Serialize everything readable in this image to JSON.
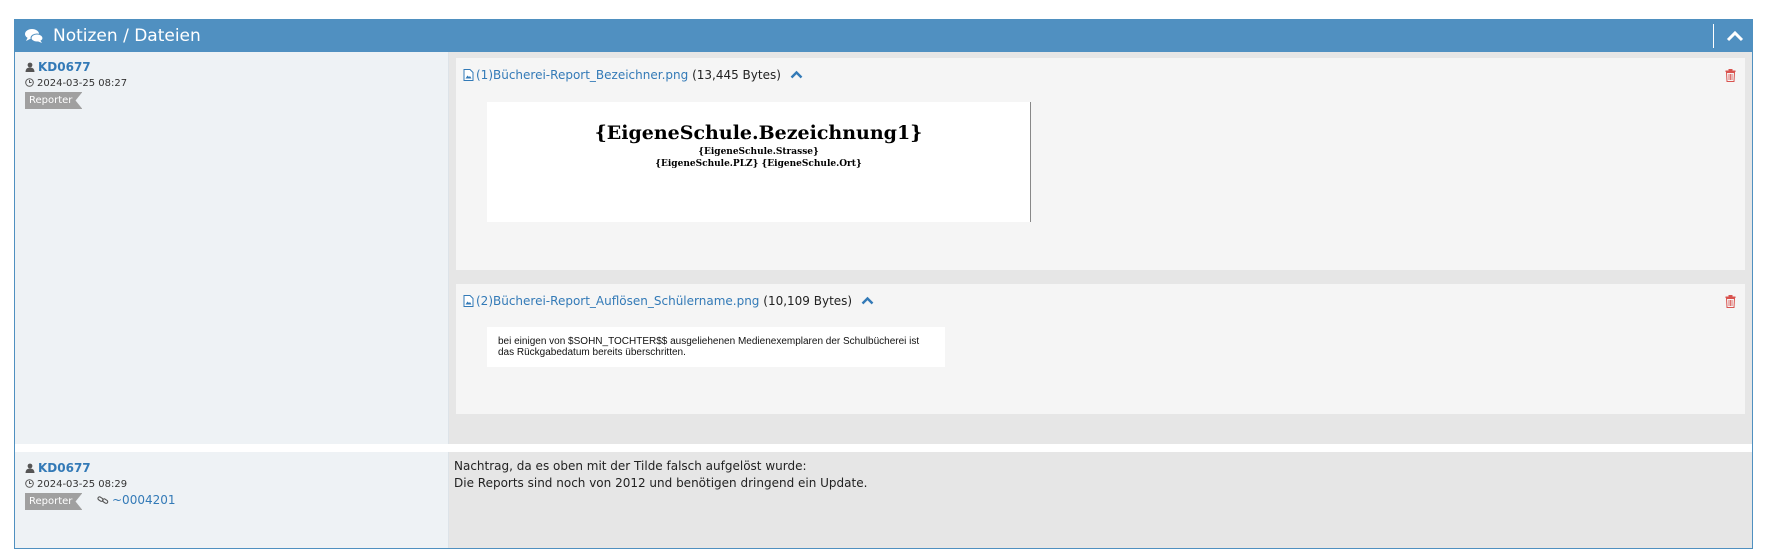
{
  "header": {
    "title": "Notizen / Dateien",
    "icon": "comments-icon",
    "collapse_icon": "chevron-up-icon"
  },
  "notes": [
    {
      "author": "KD0677",
      "timestamp": "2024-03-25 08:27",
      "role": "Reporter",
      "files": [
        {
          "name": "(1)Bücherei-Report_Bezeichner.png",
          "size": "(13,445 Bytes)",
          "preview": {
            "title": "{EigeneSchule.Bezeichnung1}",
            "line1": "{EigeneSchule.Strasse}",
            "line2": "{EigeneSchule.PLZ} {EigeneSchule.Ort}"
          }
        },
        {
          "name": "(2)Bücherei-Report_Auflösen_Schülername.png",
          "size": "(10,109 Bytes)",
          "preview": {
            "line1": "bei einigen von $SOHN_TOCHTER$$ ausgeliehenen Medienexemplaren der Schulbücherei ist",
            "line2": "das Rückgabedatum bereits überschritten."
          }
        }
      ]
    },
    {
      "author": "KD0677",
      "timestamp": "2024-03-25 08:29",
      "role": "Reporter",
      "link": "~0004201",
      "text_line1": "Nachtrag, da es oben mit der Tilde falsch aufgelöst wurde:",
      "text_line2": "Die Reports sind noch von 2012 und benötigen dringend ein Update."
    }
  ],
  "colors": {
    "header_bg": "#5090c1",
    "link": "#337ab7",
    "delete": "#d9534f",
    "role_badge": "#a0a0a0"
  }
}
